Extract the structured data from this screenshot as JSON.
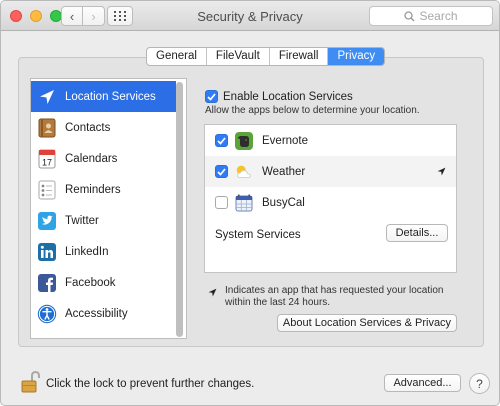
{
  "window": {
    "title": "Security & Privacy",
    "search_placeholder": "Search"
  },
  "tabs": [
    {
      "label": "General",
      "active": false
    },
    {
      "label": "FileVault",
      "active": false
    },
    {
      "label": "Firewall",
      "active": false
    },
    {
      "label": "Privacy",
      "active": true
    }
  ],
  "sidebar": {
    "items": [
      {
        "label": "Location Services",
        "icon": "location-arrow-icon",
        "selected": true
      },
      {
        "label": "Contacts",
        "icon": "contacts-book-icon",
        "selected": false
      },
      {
        "label": "Calendars",
        "icon": "calendar-icon",
        "selected": false
      },
      {
        "label": "Reminders",
        "icon": "reminders-list-icon",
        "selected": false
      },
      {
        "label": "Twitter",
        "icon": "twitter-bird-icon",
        "selected": false
      },
      {
        "label": "LinkedIn",
        "icon": "linkedin-icon",
        "selected": false
      },
      {
        "label": "Facebook",
        "icon": "facebook-icon",
        "selected": false
      },
      {
        "label": "Accessibility",
        "icon": "accessibility-icon",
        "selected": false
      }
    ]
  },
  "main": {
    "enable_label": "Enable Location Services",
    "enable_checked": true,
    "subnote": "Allow the apps below to determine your location.",
    "apps": [
      {
        "name": "Evernote",
        "checked": true,
        "icon": "evernote-elephant-icon",
        "recent": false
      },
      {
        "name": "Weather",
        "checked": true,
        "icon": "weather-sun-cloud-icon",
        "recent": true
      },
      {
        "name": "BusyCal",
        "checked": false,
        "icon": "busycal-calendar-icon",
        "recent": false
      }
    ],
    "system_services_label": "System Services",
    "details_button": "Details...",
    "legend_text": "Indicates an app that has requested your location within the last 24 hours.",
    "about_button": "About Location Services & Privacy"
  },
  "footer": {
    "lock_text": "Click the lock to prevent further changes.",
    "advanced_button": "Advanced...",
    "help_button": "?"
  },
  "colors": {
    "accent": "#2b6ee6",
    "tab_active": "#3f8cf3",
    "checkbox": "#2f7cf6"
  }
}
